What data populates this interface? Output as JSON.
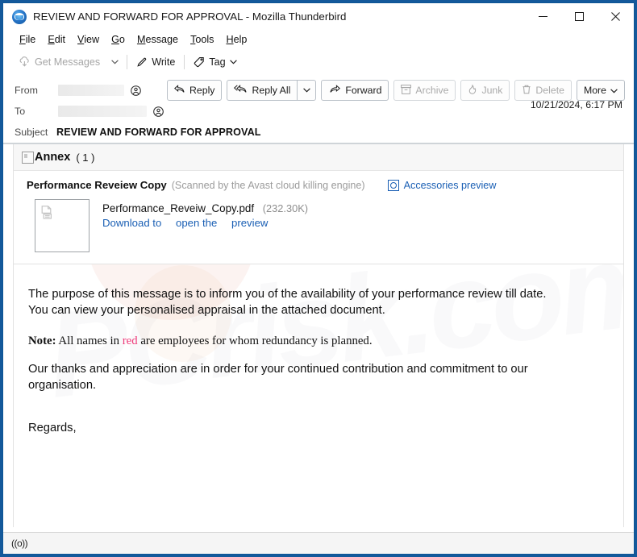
{
  "window": {
    "title": "REVIEW AND FORWARD FOR APPROVAL - Mozilla Thunderbird",
    "logo_icon": "thunderbird-logo",
    "controls": {
      "minimize": "minimize-icon",
      "maximize": "maximize-icon",
      "close": "close-icon"
    }
  },
  "menubar": {
    "items": [
      {
        "accel": "F",
        "rest": "ile"
      },
      {
        "accel": "E",
        "rest": "dit"
      },
      {
        "accel": "V",
        "rest": "iew"
      },
      {
        "accel": "G",
        "rest": "o"
      },
      {
        "accel": "M",
        "rest": "essage"
      },
      {
        "accel": "T",
        "rest": "ools"
      },
      {
        "accel": "H",
        "rest": "elp"
      }
    ]
  },
  "toolbar": {
    "get_messages": "Get Messages",
    "get_messages_caret": "chevron-down-icon",
    "write": "Write",
    "tag": "Tag",
    "tag_caret": "chevron-down-icon"
  },
  "header": {
    "from_label": "From",
    "from_value": "",
    "to_label": "To",
    "to_value": "",
    "subject_label": "Subject",
    "subject_value": "REVIEW AND FORWARD FOR APPROVAL",
    "date": "10/21/2024, 6:17 PM",
    "actions": {
      "reply": "Reply",
      "reply_all": "Reply All",
      "reply_all_caret": "chevron-down-icon",
      "forward": "Forward",
      "archive": "Archive",
      "junk": "Junk",
      "delete": "Delete",
      "more": "More",
      "more_caret": "chevron-down-icon"
    }
  },
  "attachments": {
    "annex_label": "Annex",
    "annex_count": "( 1 )",
    "annex_icon": "broken-image-icon",
    "title": "Performance Reveiew Copy",
    "scanned_note": "(Scanned by the Avast cloud killing engine)",
    "preview_link": "Accessories preview",
    "preview_icon": "magnifier-box-icon",
    "thumb_icon": "document-icon",
    "file_name": "Performance_Reveiw_Copy.pdf",
    "file_size": "(232.30K)",
    "links": [
      "Download to",
      "open the",
      "preview"
    ]
  },
  "body": {
    "p1_line1": "The purpose of this message is to inform you of the availability of your performance review till date.",
    "p1_line2": "You can view your personalised appraisal in the attached document.",
    "note_bold": "Note:",
    "note_part1": " All names in ",
    "note_red": "red",
    "note_part2": " are employees for whom redundancy is planned.",
    "p3_line1": "Our thanks and appreciation are in order for your continued contribution and commitment to our",
    "p3_line2": "organisation.",
    "signature": "Regards,",
    "watermark": "PCrisk.com",
    "red_color": "#ef3b7a",
    "link_color": "#1a5fb4"
  },
  "statusbar": {
    "icon": "broadcast-icon",
    "icon_glyph": "((o))"
  }
}
